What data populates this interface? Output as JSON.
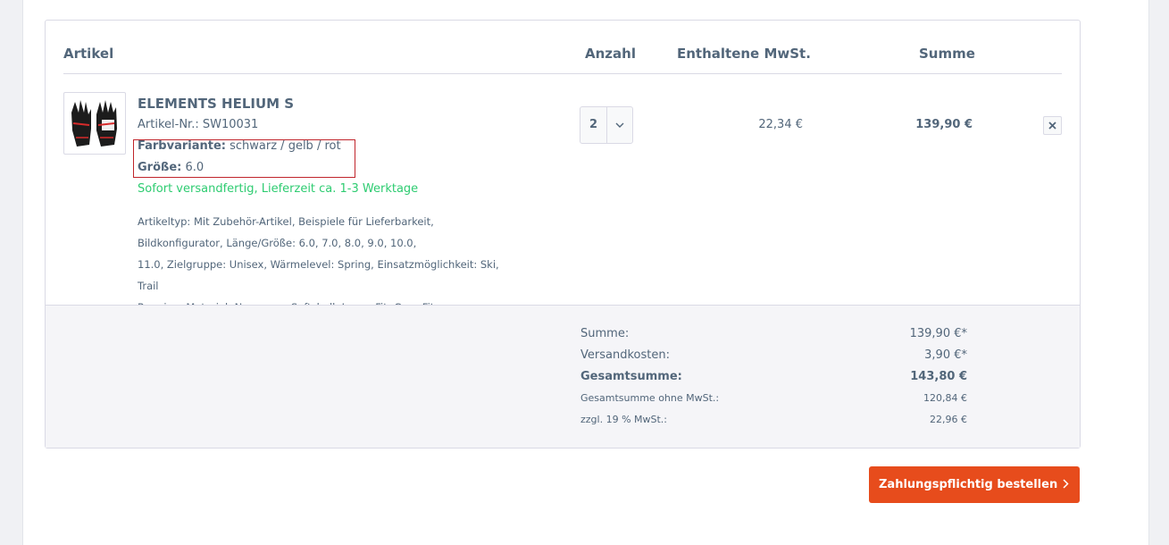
{
  "table": {
    "headers": {
      "article": "Artikel",
      "quantity": "Anzahl",
      "vat": "Enthaltene MwSt.",
      "total": "Summe"
    }
  },
  "item": {
    "name": "ELEMENTS HELIUM S",
    "article_no_label": "Artikel-Nr.:",
    "article_no": "SW10031",
    "variant_label": "Farbvariante:",
    "variant_value": "schwarz / gelb / rot",
    "size_label": "Größe:",
    "size_value": "6.0",
    "delivery": "Sofort versandfertig, Lieferzeit ca. 1-3 Werktage",
    "description_lines": [
      "Artikeltyp: Mit Zubehör-Artikel, Beispiele für Lieferbarkeit,",
      "Bildkonfigurator, Länge/Größe: 6.0, 7.0, 8.0, 9.0, 10.0,",
      "11.0, Zielgruppe: Unisex, Wärmelevel: Spring, Einsatzmöglichkeit: Ski, Trail",
      "Running, Material: Neoprene, Softshell, Lycra, Fit: Cozy Fit"
    ],
    "quantity": "2",
    "vat": "22,34 €",
    "total": "139,90 €",
    "image_icon": "glove-image",
    "delete_icon": "close-icon"
  },
  "totals": {
    "sum_label": "Summe:",
    "sum_value": "139,90 €*",
    "shipping_label": "Versandkosten:",
    "shipping_value": "3,90 €*",
    "grand_label": "Gesamtsumme:",
    "grand_value": "143,80 €",
    "net_label": "Gesamtsumme ohne MwSt.:",
    "net_value": "120,84 €",
    "tax_label": "zzgl. 19 % MwSt.:",
    "tax_value": "22,96 €"
  },
  "order_button": {
    "label": "Zahlungspflichtig bestellen",
    "icon": "chevron-right-icon"
  },
  "colors": {
    "accent": "#e74c1c",
    "text": "#52667a",
    "success": "#2ecc71",
    "highlight_box": "#c0252b"
  }
}
